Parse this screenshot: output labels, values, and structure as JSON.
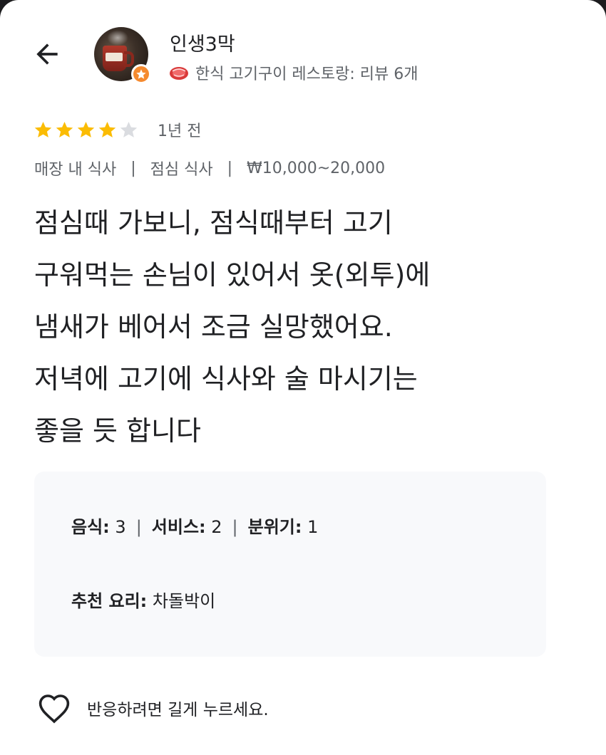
{
  "header": {
    "back_icon": "arrow-left-icon",
    "user_name": "인생3막",
    "badge_icon": "local-guide-star-icon",
    "meta_icon": "meat-icon",
    "meta_text": "한식 고기구이 레스토랑: 리뷰 6개"
  },
  "review": {
    "rating": 4,
    "max_rating": 5,
    "star_color": "#fbbc04",
    "star_empty_color": "#dadce0",
    "time": "1년 전",
    "tags": [
      "매장 내 식사",
      "점심 식사",
      "₩10,000~20,000"
    ],
    "text": "점심때 가보니, 점식때부터 고기\n구워먹는 손님이 있어서 옷(외투)에\n냄새가 베어서 조금 실망했어요.\n저녁에 고기에 식사와 술 마시기는\n좋을 듯 합니다"
  },
  "details": {
    "food_label": "음식:",
    "food_value": "3",
    "service_label": "서비스:",
    "service_value": "2",
    "atmosphere_label": "분위기:",
    "atmosphere_value": "1",
    "recommended_label": "추천 요리:",
    "recommended_value": "차돌박이"
  },
  "footer": {
    "like_icon": "heart-outline-icon",
    "like_hint": "반응하려면 길게 누르세요."
  }
}
